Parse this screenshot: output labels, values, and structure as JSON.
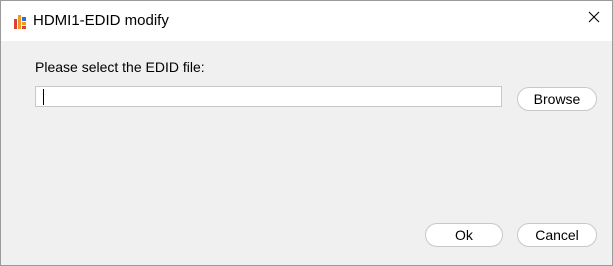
{
  "window": {
    "title": "HDMI1-EDID modify",
    "icon": "app-icon",
    "close_icon": "close-icon"
  },
  "dialog": {
    "prompt": "Please select the EDID file:",
    "file_path_value": "",
    "browse_label": "Browse",
    "ok_label": "Ok",
    "cancel_label": "Cancel"
  },
  "colors": {
    "window_bg": "#f0f0f0",
    "titlebar_bg": "#ffffff",
    "button_bg": "#ffffff",
    "border": "#c8c8c8",
    "icon_red": "#d9423a",
    "icon_orange": "#f29a1f",
    "icon_blue": "#2f6fce"
  }
}
